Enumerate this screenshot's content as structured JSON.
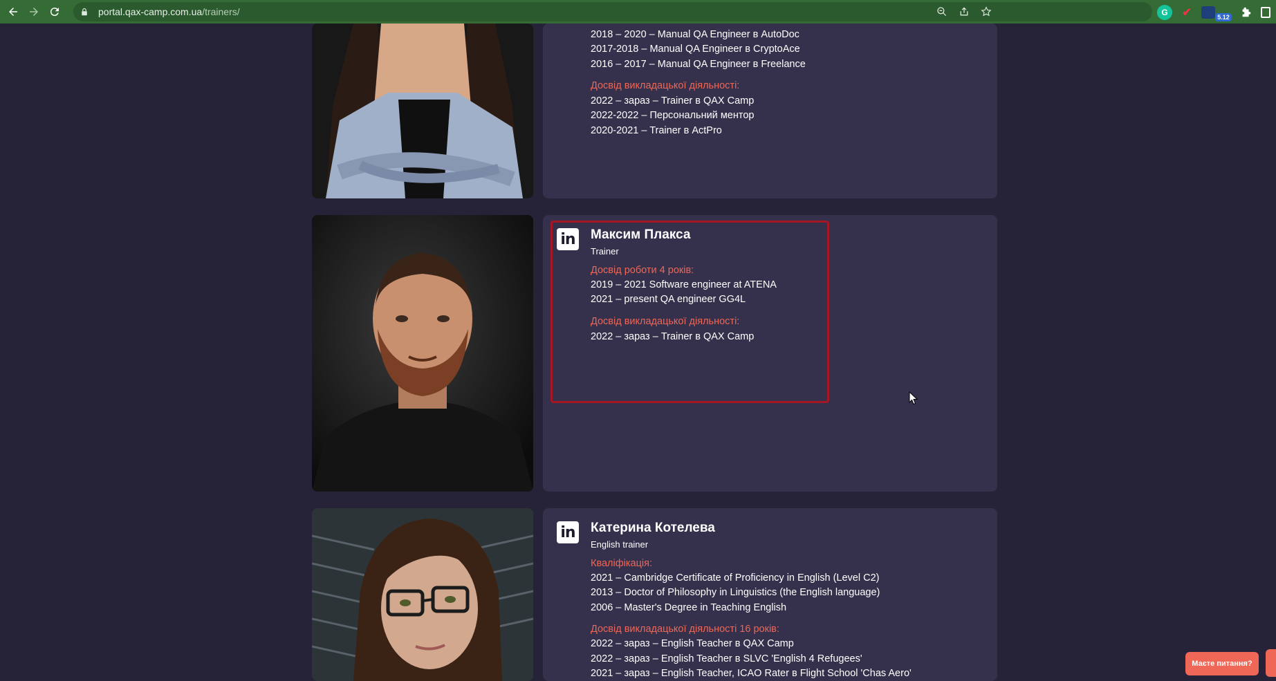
{
  "browser": {
    "url_host": "portal.qax-camp.com.ua",
    "url_path": "/trainers/",
    "extension_badge": "5.12"
  },
  "trainer1": {
    "experience_lines": [
      "2018 – 2020 – Manual QA Engineer в AutoDoc",
      "2017-2018 – Manual QA Engineer в CryptoAce",
      "2016 – 2017 – Manual QA Engineer в Freelance"
    ],
    "teaching_title": "Досвід викладацької діяльності:",
    "teaching_lines": [
      "2022 – зараз – Trainer в QAX Camp",
      "2022-2022 – Персональний ментор",
      "2020-2021 – Trainer в ActPro"
    ]
  },
  "trainer2": {
    "linkedin": "in",
    "name": "Максим Плакса",
    "role": "Trainer",
    "experience_title": "Досвід роботи 4 років:",
    "experience_lines": [
      "2019 – 2021 Software engineer at ATENA",
      "2021 – present QA engineer GG4L"
    ],
    "teaching_title": "Досвід викладацької діяльності:",
    "teaching_lines": [
      "2022 – зараз – Trainer в QAX Camp"
    ]
  },
  "trainer3": {
    "linkedin": "in",
    "name": "Катерина Котелева",
    "role": "English trainer",
    "qual_title": "Кваліфікація:",
    "qual_lines": [
      "2021 – Cambridge Certificate of Proficiency in English (Level C2)",
      "2013 – Doctor of Philosophy in Linguistics (the English language)",
      "2006 – Master's Degree in Teaching English"
    ],
    "teaching_title": "Досвід викладацької діяльності 16 років:",
    "teaching_lines": [
      "2022 – зараз – English Teacher в QAX Camp",
      "2022 – зараз – English Teacher в SLVC 'English 4 Refugees'",
      "2021 – зараз – English Teacher, ICAO Rater в Flight School 'Chas Aero'"
    ]
  },
  "chat": {
    "label": "Маєте питання?"
  },
  "colors": {
    "page_bg": "#262339",
    "card_bg": "#35304b",
    "accent": "#ef6757",
    "highlight": "#a51725",
    "browser_bar": "#356c36"
  }
}
